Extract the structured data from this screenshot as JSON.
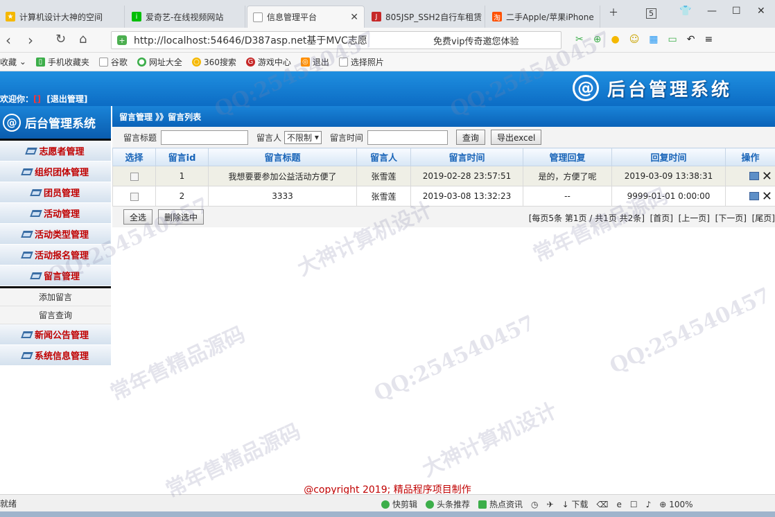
{
  "browser": {
    "tabs": [
      {
        "label": "计算机设计大神的空间",
        "icon": "star-icon",
        "color": "#f5b800"
      },
      {
        "label": "爱奇艺-在线视频网站",
        "icon": "iqiyi-icon",
        "color": "#00be06"
      },
      {
        "label": "信息管理平台",
        "icon": "page-icon",
        "color": "#999999",
        "active": true
      },
      {
        "label": "805JSP_SSH2自行车租赁",
        "icon": "jsp-icon",
        "color": "#c62828"
      },
      {
        "label": "二手Apple/苹果iPhone",
        "icon": "taobao-icon",
        "color": "#ff5000"
      }
    ],
    "tab_count": "5",
    "url": "http://localhost:54646/D387asp.net基于MVC志愿",
    "promo": "免费vip传奇邀您体验",
    "bookmarks": [
      "收藏",
      "手机收藏夹",
      "谷歌",
      "网址大全",
      "360搜索",
      "游戏中心",
      "退出",
      "选择照片"
    ],
    "status_left": "就绪",
    "status_items": [
      "快剪辑",
      "头条推荐",
      "热点资讯",
      "下载",
      "100%"
    ]
  },
  "header": {
    "welcome_label": "欢迎你：",
    "username": "[]",
    "logout": "[退出管理]",
    "logo_text": "后台管理系统"
  },
  "sidebar": {
    "logo_text": "后台管理系统",
    "items": [
      {
        "label": "志愿者管理"
      },
      {
        "label": "组织团体管理"
      },
      {
        "label": "团员管理"
      },
      {
        "label": "活动管理"
      },
      {
        "label": "活动类型管理"
      },
      {
        "label": "活动报名管理"
      },
      {
        "label": "留言管理"
      }
    ],
    "sub_items": [
      "添加留言",
      "留言查询"
    ],
    "items_after": [
      {
        "label": "新闻公告管理"
      },
      {
        "label": "系统信息管理"
      }
    ]
  },
  "main": {
    "breadcrumb": "留言管理 》》留言列表",
    "search": {
      "title_label": "留言标题",
      "title_value": "",
      "person_label": "留言人",
      "person_select": "不限制",
      "time_label": "留言时间",
      "time_value": "",
      "query_btn": "查询",
      "export_btn": "导出excel"
    },
    "table": {
      "headers": [
        "选择",
        "留言id",
        "留言标题",
        "留言人",
        "留言时间",
        "管理回复",
        "回复时间",
        "操作"
      ],
      "rows": [
        {
          "id": "1",
          "title": "我想要要参加公益活动方便了",
          "person": "张雪莲",
          "time": "2019-02-28 23:57:51",
          "reply": "是的，方便了呢",
          "reply_time": "2019-03-09 13:38:31"
        },
        {
          "id": "2",
          "title": "3333",
          "person": "张雪莲",
          "time": "2019-03-08 13:32:23",
          "reply": "--",
          "reply_time": "9999-01-01 0:00:00"
        }
      ]
    },
    "select_all_btn": "全选",
    "delete_btn": "删除选中",
    "pager": {
      "info": "[每页5条 第1页 / 共1页 共2条]",
      "first": "[首页]",
      "prev": "[上一页]",
      "next": "[下一页]",
      "last": "[尾页]"
    }
  },
  "footer": "@copyright 2019; 精品程序项目制作",
  "watermarks": [
    "QQ:254540457",
    "大神计算机设计",
    "常年售精品源码"
  ],
  "colors": {
    "header_blue": "#0c6cc4",
    "menu_text": "#c00000",
    "th_text": "#1864b8",
    "footer_text": "#c00000"
  }
}
